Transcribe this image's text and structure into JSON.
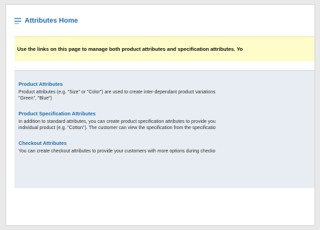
{
  "page": {
    "title": "Attributes Home",
    "banner_text": "Use the links on this page to manage both product attributes and specification attributes. Yo"
  },
  "sections": [
    {
      "link": "Product Attributes",
      "desc": "Product attributes (e.g. \"Size\" or \"Color\") are used to create inter-dependant product variations\n\"Green\", \"Blue\")"
    },
    {
      "link": "Product Specification Attributes",
      "desc": "In addition to standard attributes, you can create product specification attributes to provide you\nindividual product (e.g. \"Cotton\"). The customer can view the specification from the specificatio"
    },
    {
      "link": "Checkout Attributes",
      "desc": "You can create checkout attributes to provide your customers with more options during checko"
    }
  ],
  "colors": {
    "link": "#1f6fb2",
    "banner_bg": "#fefcc8",
    "section_bg": "#e7edf2"
  },
  "icons": {
    "title_icon": "list-icon"
  }
}
